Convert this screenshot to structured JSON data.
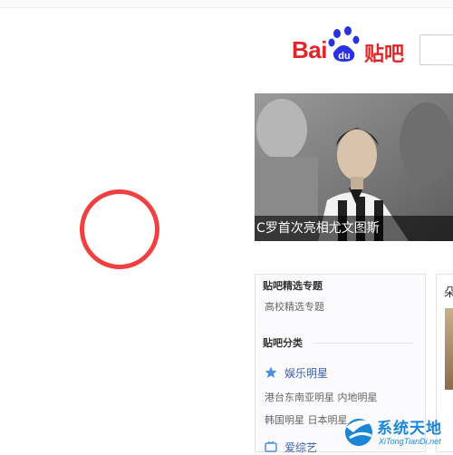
{
  "header": {
    "logo_bai": "Bai",
    "logo_du": "du",
    "logo_tieba": "贴吧",
    "search_placeholder": ""
  },
  "banner": {
    "caption": "C罗首次亮相尤文图斯"
  },
  "side_panel": {
    "featured_title": "贴吧精选专题",
    "featured_link": "高校精选专题",
    "category_title": "贴吧分类",
    "entertainment_label": "娱乐明星",
    "entertainment_sub1": "港台东南亚明星  内地明星",
    "entertainment_sub2": "韩国明星  日本明星",
    "variety_label": "爱综艺"
  },
  "right_card": {
    "title": "朵"
  },
  "watermark": {
    "name": "系统天地",
    "url": "XiTongTianDi.net"
  },
  "colors": {
    "baidu_red": "#e1262a",
    "baidu_blue": "#2932e1",
    "link_blue": "#3a5ea8",
    "ring": "#f04040",
    "watermark_blue": "#1a86d8"
  },
  "icons": [
    "baidu-paw-icon",
    "star-icon",
    "tv-icon",
    "watermark-logo-icon"
  ]
}
